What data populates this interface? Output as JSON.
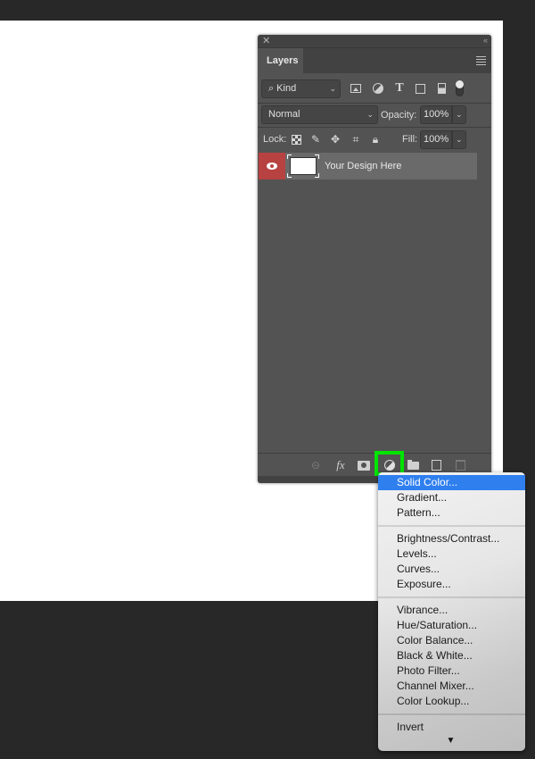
{
  "panel": {
    "close_glyph": "✕",
    "collapse_glyph": "‹‹",
    "tab_label": "Layers",
    "filter": {
      "search_glyph": "⌕",
      "selected": "Kind",
      "icons": [
        "image-filter-icon",
        "adjustment-filter-icon",
        "type-filter-icon",
        "shape-filter-icon",
        "smart-object-filter-icon"
      ],
      "type_glyph": "T"
    },
    "blend_mode": "Normal",
    "opacity_label": "Opacity:",
    "opacity_value": "100%",
    "lock_label": "Lock:",
    "fill_label": "Fill:",
    "fill_value": "100%",
    "lock_glyphs": {
      "paint": "✎",
      "move": "✥",
      "artboard": "⌗",
      "all": "🔒︎"
    },
    "layers": [
      {
        "name": "Your Design Here",
        "visible": true
      }
    ],
    "footer": {
      "link_glyph": "⊖",
      "fx_label": "fx",
      "trash_glyph": ""
    }
  },
  "dropdown": {
    "groups": [
      [
        "Solid Color...",
        "Gradient...",
        "Pattern..."
      ],
      [
        "Brightness/Contrast...",
        "Levels...",
        "Curves...",
        "Exposure..."
      ],
      [
        "Vibrance...",
        "Hue/Saturation...",
        "Color Balance...",
        "Black & White...",
        "Photo Filter...",
        "Channel Mixer...",
        "Color Lookup..."
      ],
      [
        "Invert"
      ]
    ],
    "selected": "Solid Color...",
    "more_arrow": "▼"
  },
  "colors": {
    "highlight_box": "#00e400",
    "selection_blue": "#2f7fef",
    "visibility_red": "#b84141"
  }
}
